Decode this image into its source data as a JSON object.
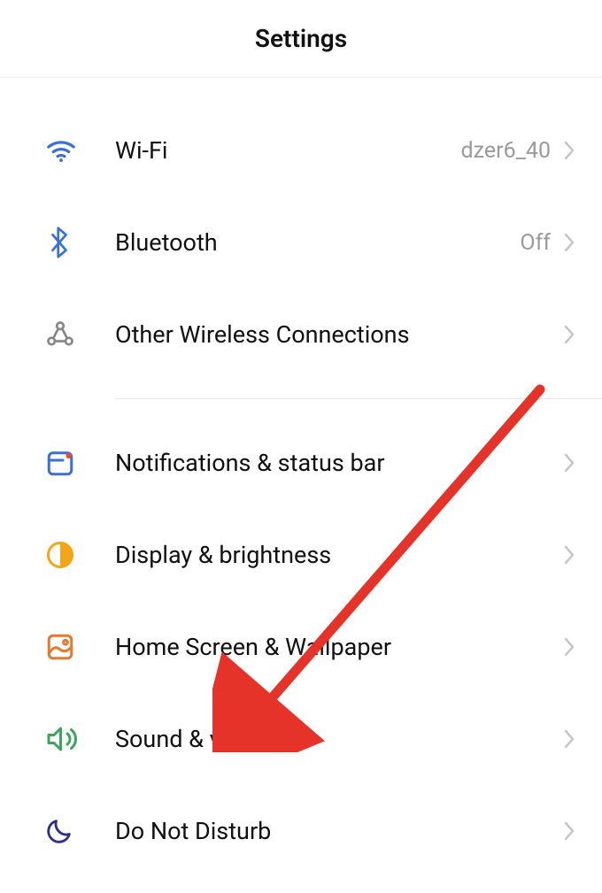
{
  "header": {
    "title": "Settings"
  },
  "items": [
    {
      "label": "Wi-Fi",
      "value": "dzer6_40"
    },
    {
      "label": "Bluetooth",
      "value": "Off"
    },
    {
      "label": "Other Wireless Connections",
      "value": ""
    },
    {
      "label": "Notifications & status bar",
      "value": ""
    },
    {
      "label": "Display & brightness",
      "value": ""
    },
    {
      "label": "Home Screen & Wallpaper",
      "value": ""
    },
    {
      "label": "Sound & vibration",
      "value": ""
    },
    {
      "label": "Do Not Disturb",
      "value": ""
    }
  ]
}
